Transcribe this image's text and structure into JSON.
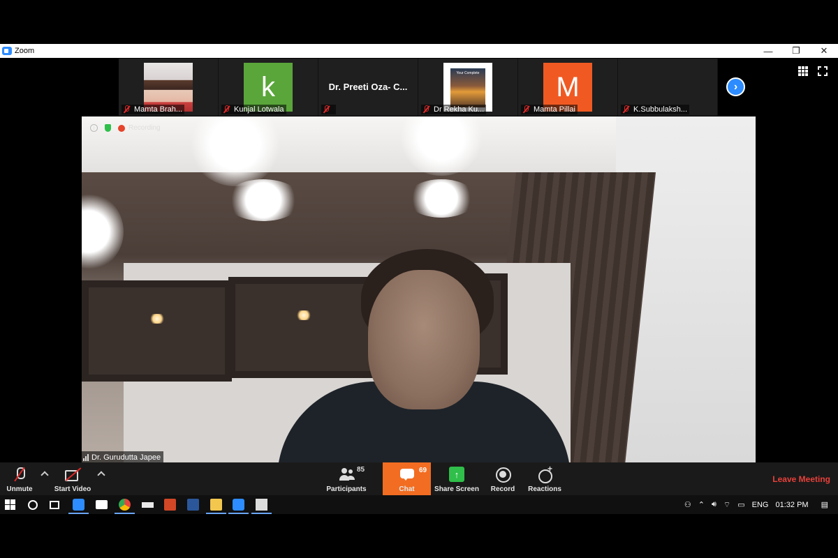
{
  "window": {
    "title": "Zoom",
    "controls": [
      "—",
      "❐",
      "✕"
    ]
  },
  "gallery": {
    "participants": [
      {
        "name": "Mamta Brah...",
        "thumb": "photo"
      },
      {
        "name": "Kunjal Lotwala",
        "thumb": "letter",
        "letter": "k",
        "color": "#5aa63a"
      },
      {
        "name": "",
        "thumb": "name-only",
        "display_name": "Dr. Preeti Oza- C..."
      },
      {
        "name": "Dr Rekha Ku...",
        "thumb": "book",
        "cover_text": "Your Complete"
      },
      {
        "name": "Mamta Pillai",
        "thumb": "letter",
        "letter": "M",
        "color": "#f05a22"
      },
      {
        "name": "K.Subbulaksh...",
        "thumb": "none"
      }
    ],
    "next_icon": "chevron-right-icon"
  },
  "video": {
    "status_recording": "Recording",
    "speaker_name": "Dr. Gurudutta Japee"
  },
  "toolbar": {
    "unmute_label": "Unmute",
    "start_video_label": "Start Video",
    "participants_label": "Participants",
    "participants_count": "85",
    "chat_label": "Chat",
    "chat_count": "69",
    "share_label": "Share Screen",
    "record_label": "Record",
    "reactions_label": "Reactions",
    "leave_label": "Leave Meeting",
    "share_arrow": "↑"
  },
  "taskbar": {
    "language": "ENG",
    "time": "01:32 PM"
  },
  "colors": {
    "accent": "#2d8cff",
    "chat_active": "#f26d21",
    "share_green": "#2fbf4a",
    "leave_red": "#e8403a",
    "mute_red": "#e02828"
  }
}
